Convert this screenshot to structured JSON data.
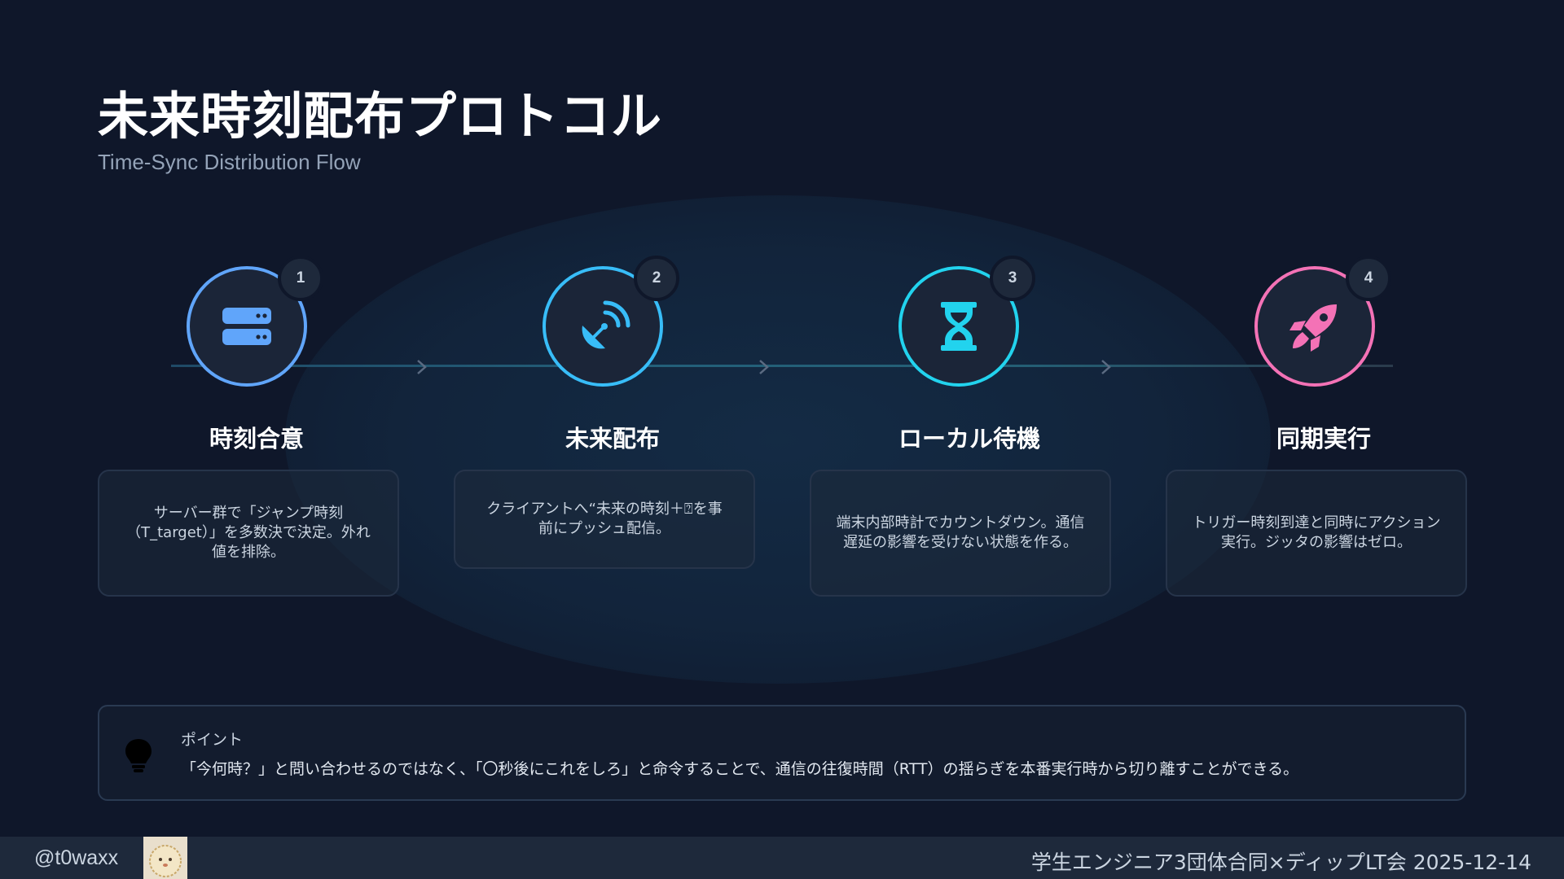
{
  "slide": {
    "title": "未来時刻配布プロトコル",
    "subtitle": "Time-Sync Distribution Flow"
  },
  "steps": [
    {
      "number": "1",
      "title": "時刻合意",
      "icon": "server-icon",
      "color": "#60a5fa",
      "description": "サーバー群で「ジャンプ時刻（T_target）」を多数決で決定。外れ値を排除。"
    },
    {
      "number": "2",
      "title": "未来配布",
      "icon": "satellite-dish-icon",
      "color": "#38bdf8",
      "description": "クライアントへ“未来の時刻＋⍰を事前にプッシュ配信。"
    },
    {
      "number": "3",
      "title": "ローカル待機",
      "icon": "hourglass-icon",
      "color": "#22d3ee",
      "description": "端末内部時計でカウントダウン。通信遅延の影響を受けない状態を作る。"
    },
    {
      "number": "4",
      "title": "同期実行",
      "icon": "rocket-icon",
      "color": "#f472b6",
      "description": "トリガー時刻到達と同時にアクション実行。ジッタの影響はゼロ。"
    }
  ],
  "point": {
    "label": "ポイント",
    "text": "「今何時？」と問い合わせるのではなく、「〇秒後にこれをしろ」と命令することで、通信の往復時間（RTT）の揺らぎを本番実行時から切り離すことができる。",
    "icon": "lightbulb-icon"
  },
  "footer": {
    "handle": "@t0waxx",
    "event": "学生エンジニア3団体合同×ディップLT会 2025-12-14"
  },
  "colors": {
    "background": "#0f172a",
    "card_border": "#26344a",
    "text_muted": "#94a3b8"
  }
}
